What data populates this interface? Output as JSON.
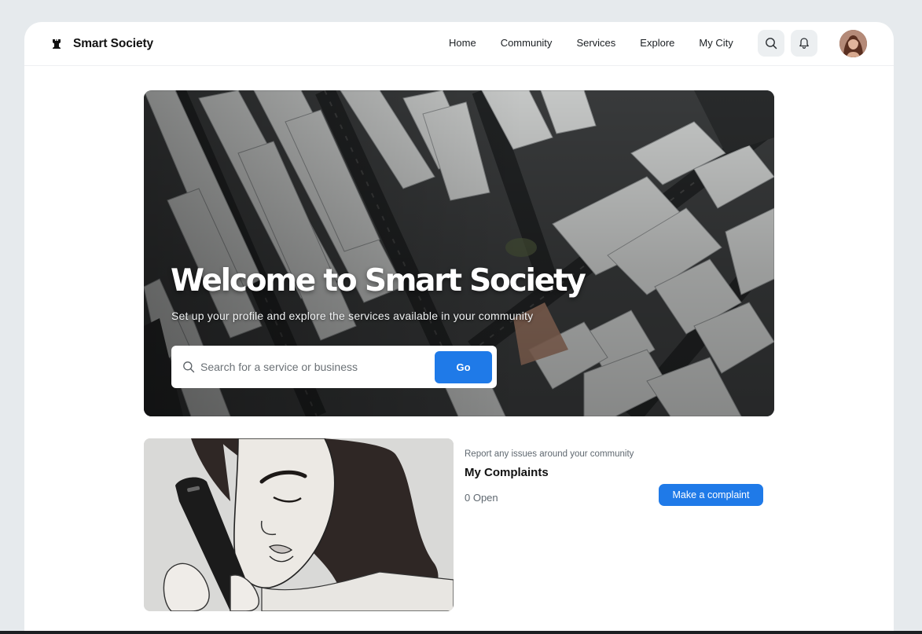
{
  "brand": {
    "name": "Smart Society",
    "logo_icon": "rook-icon"
  },
  "nav": {
    "items": [
      {
        "label": "Home"
      },
      {
        "label": "Community"
      },
      {
        "label": "Services"
      },
      {
        "label": "Explore"
      },
      {
        "label": "My City"
      }
    ],
    "icons": [
      "search-icon",
      "bell-icon"
    ],
    "avatar": "user-avatar"
  },
  "hero": {
    "title": "Welcome to Smart Society",
    "subtitle": "Set up your profile and explore the services available in your community",
    "search": {
      "placeholder": "Search for a service or business",
      "value": "",
      "button": "Go"
    }
  },
  "complaints": {
    "caption": "Report any issues around your community",
    "title": "My Complaints",
    "count_text": "0 Open",
    "button": "Make a complaint"
  },
  "colors": {
    "accent": "#1f7ae8",
    "page_bg": "#e6eaed",
    "card_bg": "#ffffff"
  }
}
